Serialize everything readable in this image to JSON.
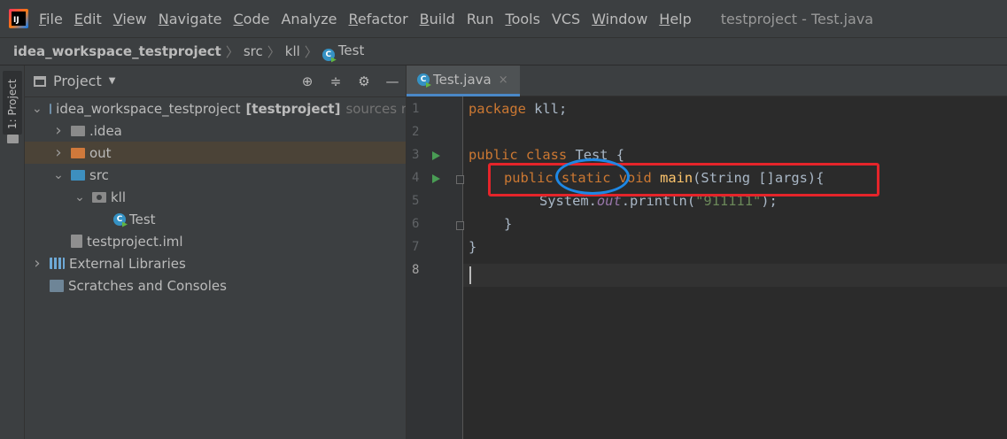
{
  "app": {
    "logo_icon": "intellij-idea-icon",
    "logo_text": "IJ",
    "window_title": "testproject - Test.java"
  },
  "menu": [
    {
      "label": "File",
      "mnemonic": "F",
      "rest": "ile"
    },
    {
      "label": "Edit",
      "mnemonic": "E",
      "rest": "dit"
    },
    {
      "label": "View",
      "mnemonic": "V",
      "rest": "iew"
    },
    {
      "label": "Navigate",
      "mnemonic": "N",
      "rest": "avigate"
    },
    {
      "label": "Code",
      "mnemonic": "C",
      "rest": "ode"
    },
    {
      "label": "Analyze",
      "mnemonic": "",
      "rest": "Analyze"
    },
    {
      "label": "Refactor",
      "mnemonic": "R",
      "rest": "efactor"
    },
    {
      "label": "Build",
      "mnemonic": "B",
      "rest": "uild"
    },
    {
      "label": "Run",
      "mnemonic": "",
      "rest": "Run"
    },
    {
      "label": "Tools",
      "mnemonic": "T",
      "rest": "ools"
    },
    {
      "label": "VCS",
      "mnemonic": "",
      "rest": "VCS"
    },
    {
      "label": "Window",
      "mnemonic": "W",
      "rest": "indow"
    },
    {
      "label": "Help",
      "mnemonic": "H",
      "rest": "elp"
    }
  ],
  "breadcrumb": [
    {
      "label": "idea_workspace_testproject",
      "bold": true
    },
    {
      "label": "src"
    },
    {
      "label": "kll"
    },
    {
      "label": "Test",
      "icon": "java-class-icon"
    }
  ],
  "toolstrip": {
    "project_tab": "1: Project"
  },
  "project_panel": {
    "title": "Project",
    "tools": [
      "locate-icon",
      "collapse-icon",
      "gear-icon",
      "minimize-icon"
    ],
    "tree": [
      {
        "label": "idea_workspace_testproject",
        "bold_suffix": "[testproject]",
        "muted_suffix": "sources r",
        "depth": 0,
        "arrow": "down",
        "icon": "module-icon"
      },
      {
        "label": ".idea",
        "depth": 1,
        "arrow": "right",
        "icon": "folder-icon"
      },
      {
        "label": "out",
        "depth": 1,
        "arrow": "right",
        "icon": "excluded-folder-icon",
        "selected": true
      },
      {
        "label": "src",
        "depth": 1,
        "arrow": "down",
        "icon": "source-folder-icon"
      },
      {
        "label": "kll",
        "depth": 2,
        "arrow": "down",
        "icon": "package-icon"
      },
      {
        "label": "Test",
        "depth": 3,
        "arrow": "none",
        "icon": "java-class-icon"
      },
      {
        "label": "testproject.iml",
        "depth": 1,
        "arrow": "none",
        "icon": "iml-file-icon"
      },
      {
        "label": "External Libraries",
        "depth": 0,
        "arrow": "right",
        "icon": "libraries-icon"
      },
      {
        "label": "Scratches and Consoles",
        "depth": 0,
        "arrow": "none",
        "icon": "scratches-icon"
      }
    ]
  },
  "editor": {
    "tab": {
      "label": "Test.java",
      "close": "×"
    },
    "line_numbers": [
      "1",
      "2",
      "3",
      "4",
      "5",
      "6",
      "7",
      "8"
    ],
    "code": {
      "l1_kw": "package",
      "l1_rest": " kll;",
      "l3_kw": "public class",
      "l3_rest": " Test {",
      "l4_kw": "public static void",
      "l4_fn": "main",
      "l4_rest": "(String []args){",
      "l5_a": "System.",
      "l5_fld": "out",
      "l5_b": ".println(",
      "l5_str": "\"911111\"",
      "l5_c": ");",
      "l6": "}",
      "l7": "}"
    },
    "current_line": "8"
  },
  "annotations": {
    "box_color": "#e5242a",
    "ellipse_color": "#1e88e5"
  }
}
